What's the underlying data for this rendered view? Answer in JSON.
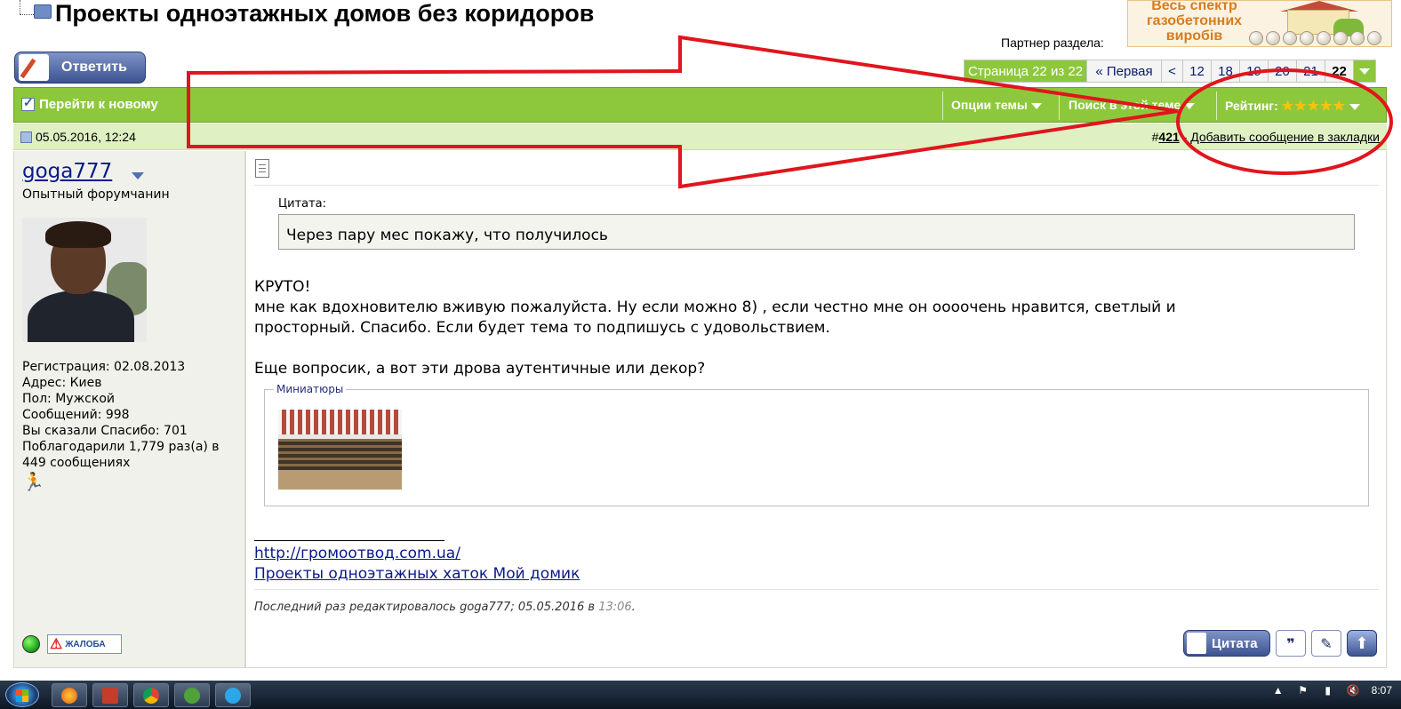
{
  "page": {
    "title": "Проекты одноэтажных домов без коридоров",
    "partner_label": "Партнер раздела:",
    "ad": {
      "line1": "Весь спектр",
      "line2": "газобетонних",
      "line3": "виробів"
    }
  },
  "actions": {
    "reply_label": "Ответить"
  },
  "pagination": {
    "status": "Страница 22 из 22",
    "first_label": "« Первая",
    "prev_label": "<",
    "pages": [
      "12",
      "18",
      "19",
      "20",
      "21"
    ],
    "current": "22",
    "menu_icon": "chevron-down-icon"
  },
  "toolbar": {
    "goto_new_label": "Перейти к новому",
    "thread_options_label": "Опции темы",
    "search_label": "Поиск в этой теме",
    "rating_label": "Рейтинг:",
    "rating_stars": "★★★★★"
  },
  "post": {
    "date": "05.05.2016, 12:24",
    "number_prefix": "#",
    "number": "421",
    "separator": "-",
    "bookmark_label": "Добавить сообщение в закладки",
    "quote": {
      "label": "Цитата:",
      "text": "Через пару мес покажу, что получилось"
    },
    "message_lines": [
      "КРУТО!",
      "мне как вдохновителю вживую пожалуйста. Ну если можно 8) , если честно мне он оооочень нравится, светлый и",
      "просторный. Спасибо. Если будет тема то подпишусь с удовольствием.",
      "",
      "Еще вопросик, а вот эти дрова аутентичные или декор?"
    ],
    "thumbnails_label": "Миниатюры",
    "signature": {
      "link1": "http://громоотвод.com.ua/",
      "link2": "Проекты одноэтажных хаток Мой домик"
    },
    "edited_text": "Последний раз редактировалось goga777; 05.05.2016 в",
    "edited_time": "13:06",
    "edited_end": ".",
    "quote_button_label": "Цитата"
  },
  "user": {
    "name": "goga777",
    "title": "Опытный форумчанин",
    "info": [
      "Регистрация: 02.08.2013",
      "Адрес: Киев",
      "Пол: Мужской",
      "Сообщений: 998",
      "Вы сказали Спасибо: 701",
      "Поблагодарили 1,779 раз(а) в 449 сообщениях"
    ],
    "report_label": "ЖАЛОБА"
  },
  "taskbar": {
    "clock": "8:07"
  },
  "colors": {
    "forum_green": "#8dc83c",
    "post_header_green": "#dff0c2",
    "link_blue": "#0a1a8a",
    "annotation_red": "#e0151d"
  }
}
